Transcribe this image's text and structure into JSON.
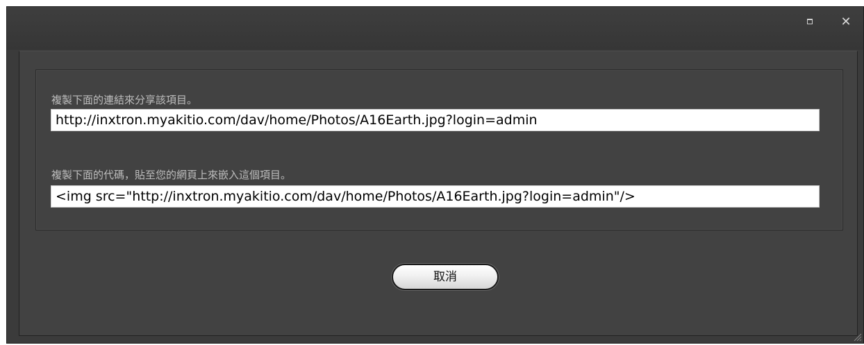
{
  "window": {
    "maximize_icon": "maximize-icon",
    "close_icon": "close-icon",
    "close_glyph": "✕"
  },
  "share": {
    "link_label": "複製下面的連結來分享該項目。",
    "link_value": "http://inxtron.myakitio.com/dav/home/Photos/A16Earth.jpg?login=admin",
    "embed_label": "複製下面的代碼，貼至您的網頁上來嵌入這個項目。",
    "embed_value": "<img src=\"http://inxtron.myakitio.com/dav/home/Photos/A16Earth.jpg?login=admin\"/>"
  },
  "actions": {
    "cancel_label": "取消"
  },
  "colors": {
    "window_bg": "#3b3b3b",
    "panel_bg": "#424242",
    "label_text": "#bdbdbd"
  }
}
